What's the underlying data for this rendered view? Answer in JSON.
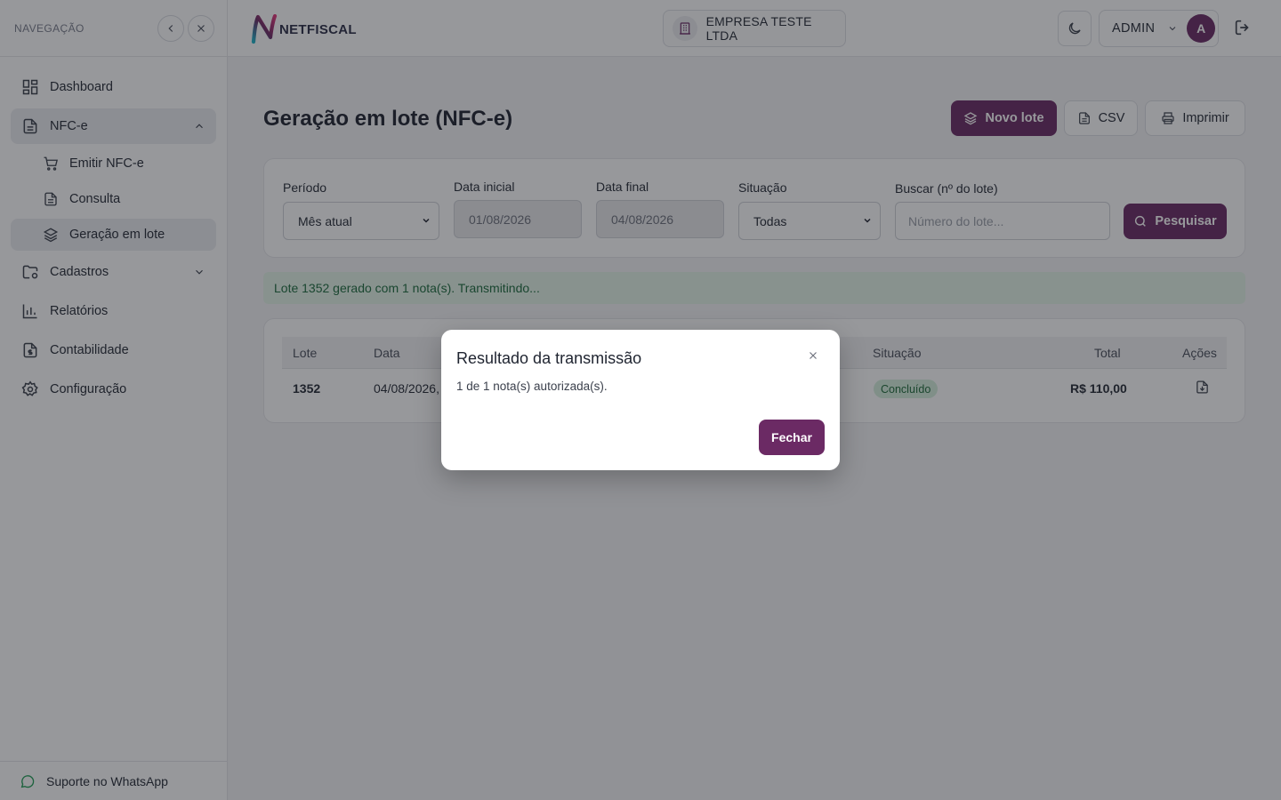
{
  "sidebar": {
    "title": "NAVEGAÇÃO",
    "items": [
      {
        "label": "Dashboard",
        "icon": "grid-icon"
      },
      {
        "label": "NFC-e",
        "icon": "document-icon",
        "expanded": true
      },
      {
        "label": "Cadastros",
        "icon": "folder-settings-icon"
      },
      {
        "label": "Relatórios",
        "icon": "bar-chart-icon"
      },
      {
        "label": "Contabilidade",
        "icon": "file-dollar-icon"
      },
      {
        "label": "Configuração",
        "icon": "gear-icon"
      }
    ],
    "subitems": [
      {
        "label": "Emitir NFC-e",
        "icon": "cart-icon"
      },
      {
        "label": "Consulta",
        "icon": "document-icon"
      },
      {
        "label": "Geração em lote",
        "icon": "layers-icon",
        "active": true
      }
    ],
    "footer": "Suporte no WhatsApp"
  },
  "header": {
    "logo_text": "NETFISCAL",
    "company": "EMPRESA TESTE LTDA",
    "user": "ADMIN",
    "avatar_initial": "A"
  },
  "page": {
    "title": "Geração em lote (NFC-e)",
    "actions": {
      "new": "Novo lote",
      "csv": "CSV",
      "print": "Imprimir"
    }
  },
  "filters": {
    "period_label": "Período",
    "period_value": "Mês atual",
    "start_label": "Data inicial",
    "start_value": "01/08/2026",
    "end_label": "Data final",
    "end_value": "04/08/2026",
    "status_label": "Situação",
    "status_value": "Todas",
    "search_label": "Buscar (nº do lote)",
    "search_placeholder": "Número do lote...",
    "search_button": "Pesquisar"
  },
  "alert": "Lote 1352 gerado com 1 nota(s). Transmitindo...",
  "table": {
    "headers": {
      "lote": "Lote",
      "data": "Data",
      "situacao": "Situação",
      "total": "Total",
      "acoes": "Ações"
    },
    "rows": [
      {
        "lote": "1352",
        "data": "04/08/2026,",
        "situacao": "Concluído",
        "total": "R$ 110,00"
      }
    ]
  },
  "modal": {
    "title": "Resultado da transmissão",
    "message": "1 de 1 nota(s) autorizada(s).",
    "button": "Fechar"
  },
  "colors": {
    "brand": "#6b2a64",
    "success_bg": "#e3f4e8",
    "success_text": "#1c6b3c"
  }
}
